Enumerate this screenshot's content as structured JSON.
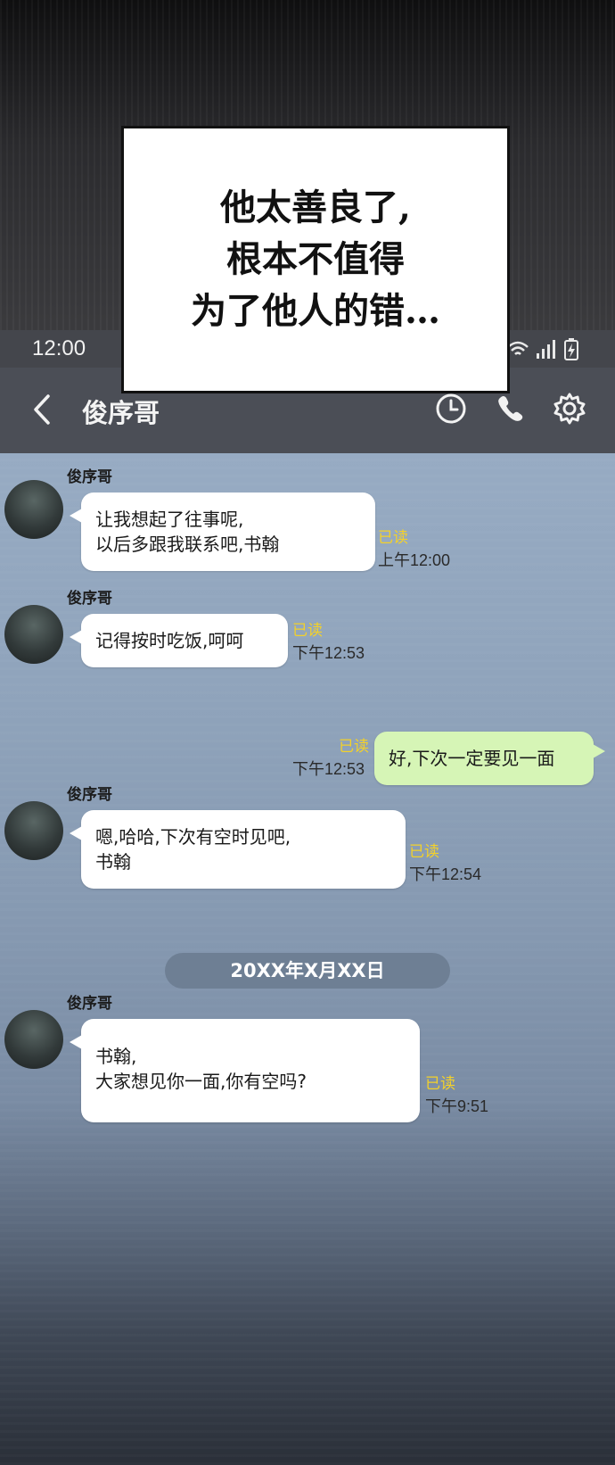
{
  "status_bar": {
    "time": "12:00"
  },
  "caption": {
    "lines": [
      "他太善良了,",
      "根本不值得",
      "为了他人的错…"
    ]
  },
  "header": {
    "title": "俊序哥",
    "back_icon": "back-chevron-icon",
    "icons": [
      "clock-icon",
      "phone-icon",
      "gear-icon"
    ]
  },
  "messages": [
    {
      "sender": "俊序哥",
      "direction": "incoming",
      "lines": [
        "让我想起了往事呢,",
        "以后多跟我联系吧,书翰"
      ],
      "read": "已读",
      "time": "上午12:00"
    },
    {
      "sender": "俊序哥",
      "direction": "incoming",
      "lines": [
        "记得按时吃饭,呵呵"
      ],
      "read": "已读",
      "time": "下午12:53"
    },
    {
      "sender": "",
      "direction": "outgoing",
      "lines": [
        "好,下次一定要见一面"
      ],
      "read": "已读",
      "time": "下午12:53"
    },
    {
      "sender": "俊序哥",
      "direction": "incoming",
      "lines": [
        "嗯,哈哈,下次有空时见吧,",
        "书翰"
      ],
      "read": "已读",
      "time": "下午12:54"
    },
    {
      "sender": "俊序哥",
      "direction": "incoming",
      "lines": [
        "书翰,",
        "大家想见你一面,你有空吗?"
      ],
      "read": "已读",
      "time": "下午9:51"
    }
  ],
  "date_divider": "20XX年X月XX日",
  "colors": {
    "read_receipt": "#f3d12a",
    "outgoing_bubble": "#d6f5b6",
    "incoming_bubble": "#ffffff",
    "header_bg": "#4b4e56"
  }
}
